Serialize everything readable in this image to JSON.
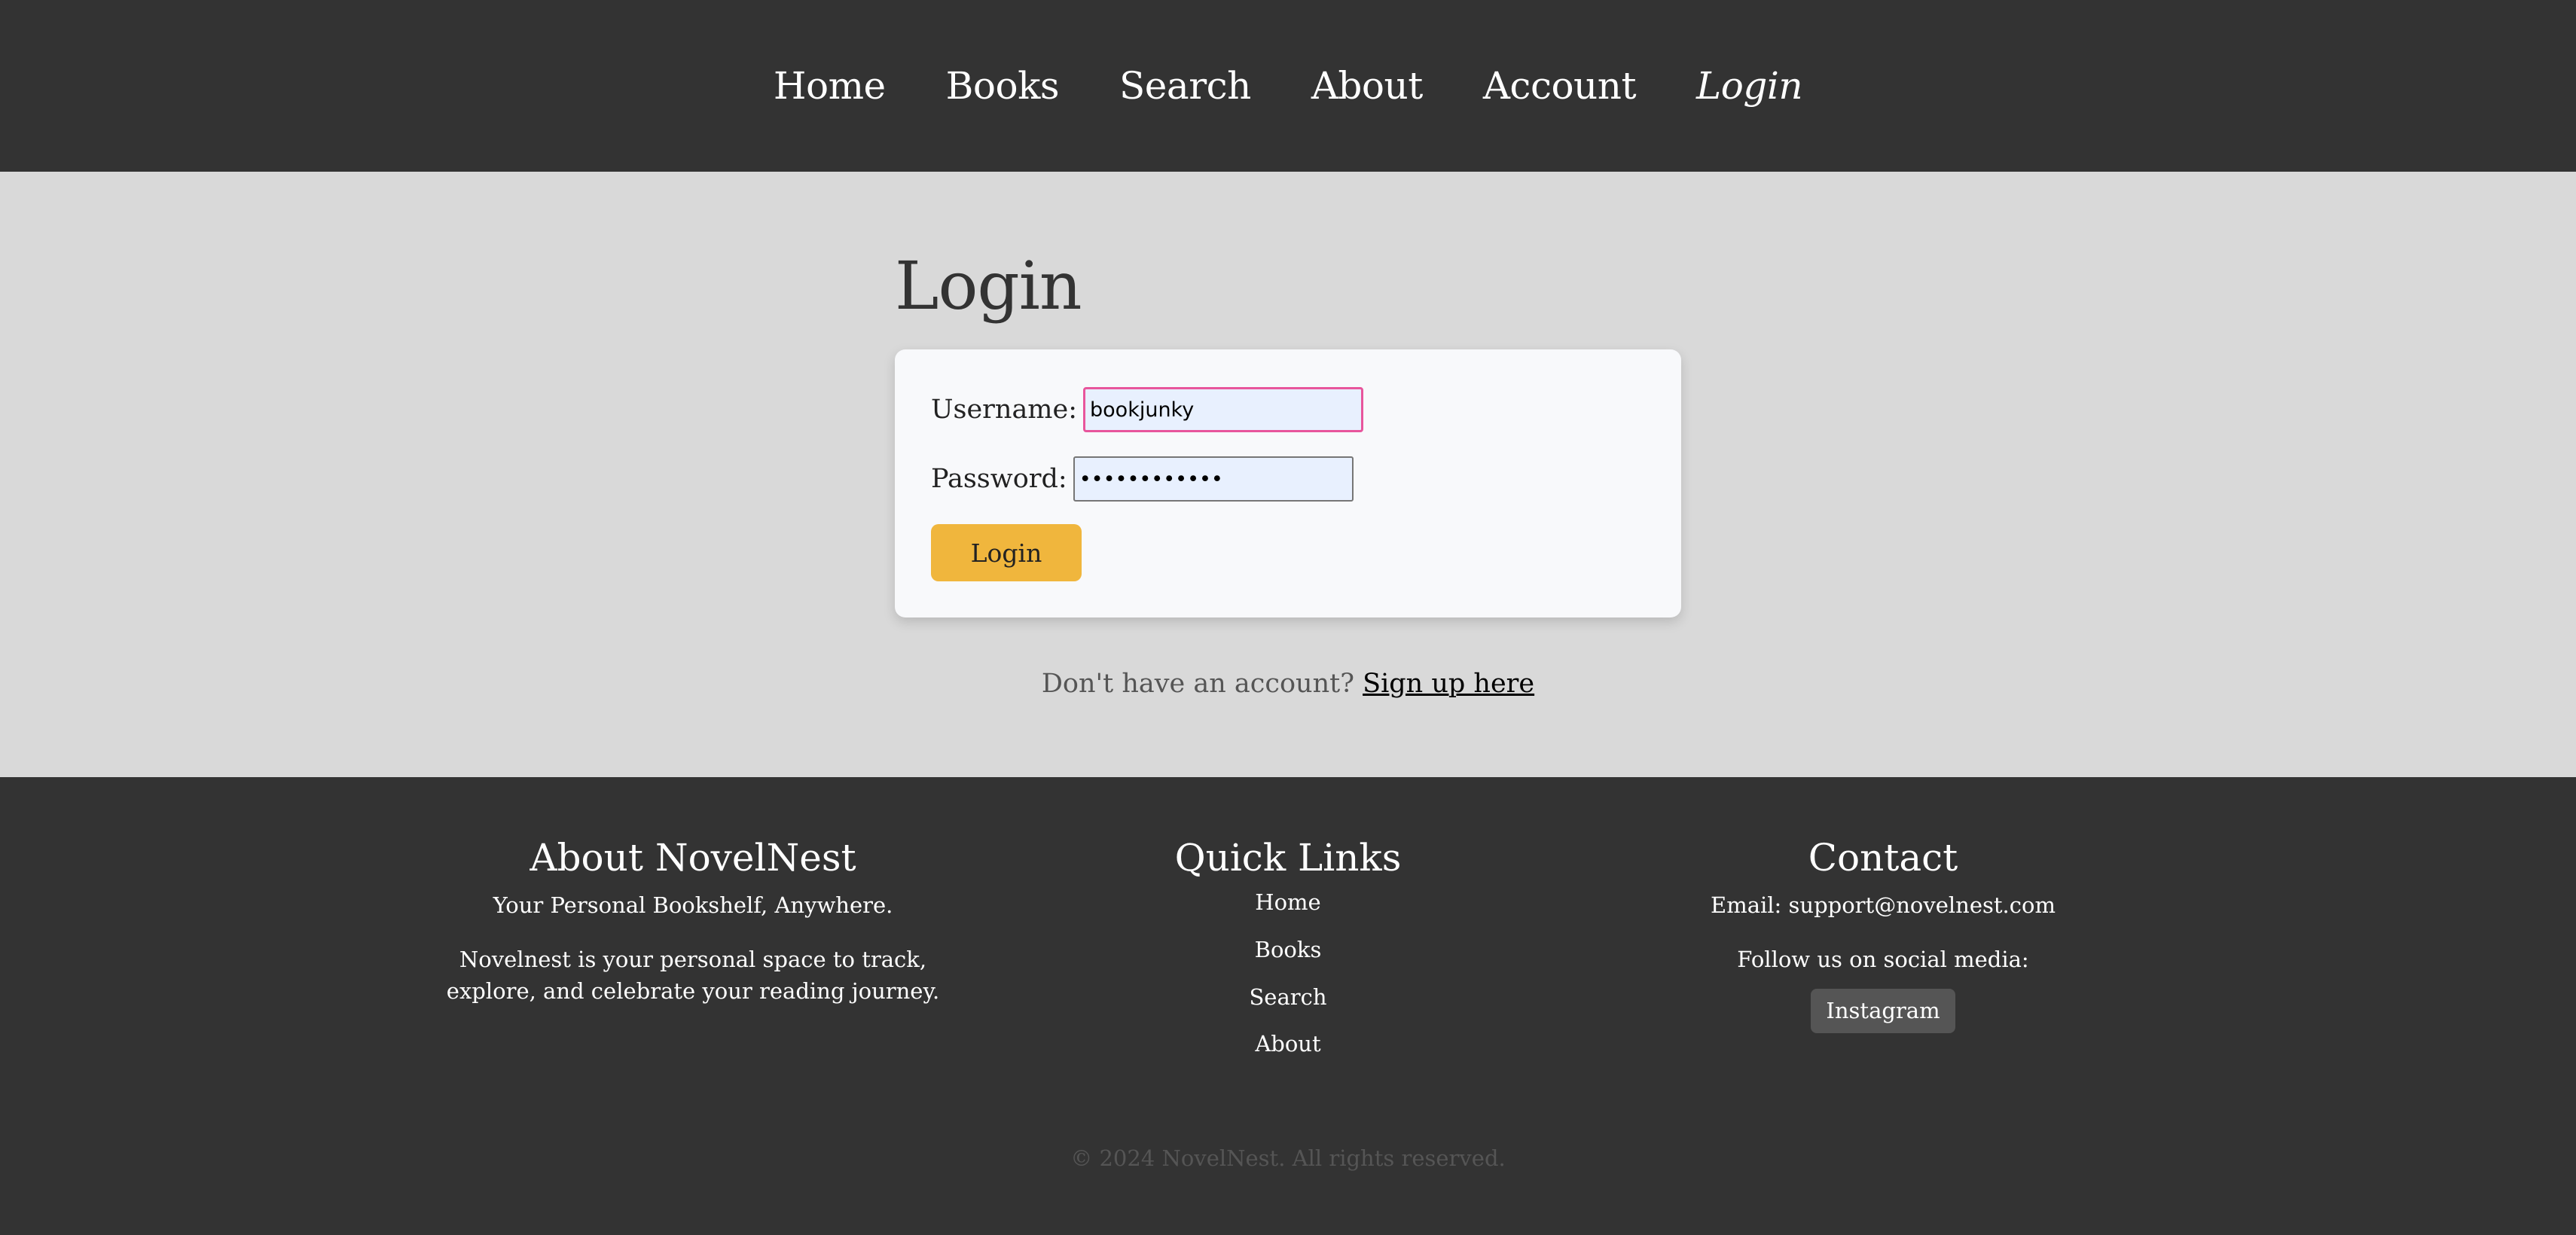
{
  "nav": {
    "items": [
      {
        "label": "Home",
        "active": false
      },
      {
        "label": "Books",
        "active": false
      },
      {
        "label": "Search",
        "active": false
      },
      {
        "label": "About",
        "active": false
      },
      {
        "label": "Account",
        "active": false
      },
      {
        "label": "Login",
        "active": true
      }
    ]
  },
  "login": {
    "title": "Login",
    "username_label": "Username:",
    "username_value": "bookjunky",
    "password_label": "Password:",
    "password_value": "bookjunky123",
    "submit_label": "Login",
    "signup_prompt": "Don't have an account?",
    "signup_link": "Sign up here"
  },
  "footer": {
    "about": {
      "heading": "About NovelNest",
      "tagline": "Your Personal Bookshelf, Anywhere.",
      "description": "Novelnest is your personal space to track, explore, and celebrate your reading journey."
    },
    "quick_links": {
      "heading": "Quick Links",
      "items": [
        "Home",
        "Books",
        "Search",
        "About"
      ]
    },
    "contact": {
      "heading": "Contact",
      "email": "Email: support@novelnest.com",
      "social_prompt": "Follow us on social media:",
      "instagram_label": "Instagram"
    },
    "copyright": "© 2024 NovelNest. All rights reserved."
  },
  "colors": {
    "header_bg": "#333333",
    "main_bg": "#d9d9d9",
    "card_bg": "#f8f9fb",
    "button_accent": "#f0b63d",
    "focus_border": "#e8559c",
    "autofill_bg": "#e8f0fe"
  }
}
